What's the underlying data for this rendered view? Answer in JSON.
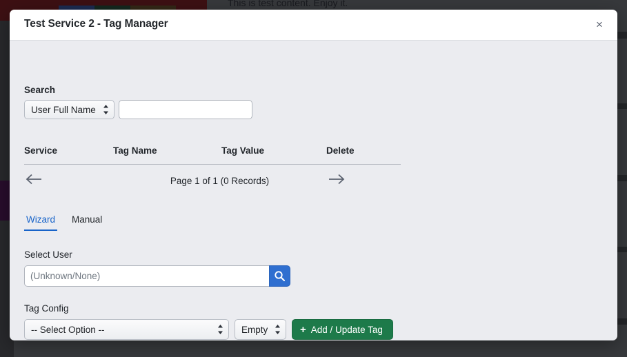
{
  "background": {
    "content_text": "This is test content. Enjoy it."
  },
  "modal": {
    "title": "Test Service 2 - Tag Manager",
    "close_label": "×"
  },
  "search": {
    "label": "Search",
    "field_selected": "User Full Name",
    "field_options": [
      "User Full Name"
    ],
    "query_value": "",
    "query_placeholder": ""
  },
  "table": {
    "columns": [
      "Service",
      "Tag Name",
      "Tag Value",
      "Delete"
    ],
    "rows": [],
    "pagination": {
      "summary": "Page 1 of 1 (0 Records)",
      "prev_icon": "arrow-left-icon",
      "next_icon": "arrow-right-icon"
    }
  },
  "tabs": {
    "active": "Wizard",
    "items": [
      {
        "label": "Wizard"
      },
      {
        "label": "Manual"
      }
    ]
  },
  "select_user": {
    "label": "Select User",
    "value": "",
    "placeholder": "(Unknown/None)",
    "search_icon": "magnifier-icon"
  },
  "tag_config": {
    "label": "Tag Config",
    "option_selected": "-- Select Option --",
    "option_list": [
      "-- Select Option --"
    ],
    "value_selected": "Empty",
    "value_list": [
      "Empty"
    ],
    "add_button_label": "Add / Update Tag",
    "add_button_icon": "plus-icon"
  },
  "colors": {
    "accent_blue": "#1763c9",
    "button_blue": "#2f6fd0",
    "button_green": "#1d7a4a",
    "modal_bg": "#ebecf0",
    "header_bg": "#ffffff"
  }
}
